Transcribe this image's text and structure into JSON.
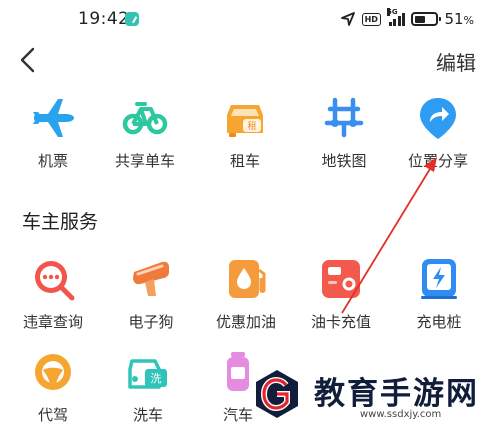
{
  "status_bar": {
    "time": "19:42",
    "network": "5G",
    "hd": "HD",
    "battery_text": "51",
    "battery_unit": "%",
    "battery_level": 0.51
  },
  "nav": {
    "back_icon": "chevron-left-icon",
    "edit_label": "编辑"
  },
  "top_grid": [
    {
      "label": "机票",
      "icon": "airplane-icon",
      "color": "#2aa3ee"
    },
    {
      "label": "共享单车",
      "icon": "bicycle-icon",
      "color": "#2ec8a0"
    },
    {
      "label": "租车",
      "icon": "rental-car-icon",
      "color": "#f7a531"
    },
    {
      "label": "地铁图",
      "icon": "subway-icon",
      "color": "#3a8ef0"
    },
    {
      "label": "位置分享",
      "icon": "location-share-icon",
      "color": "#2d9cf2"
    }
  ],
  "car_services": {
    "title": "车主服务",
    "row1": [
      {
        "label": "违章查询",
        "icon": "violation-search-icon",
        "color": "#f2554a"
      },
      {
        "label": "电子狗",
        "icon": "e-dog-icon",
        "color": "#f07a3c"
      },
      {
        "label": "优惠加油",
        "icon": "fuel-drop-icon",
        "color": "#f69b3b"
      },
      {
        "label": "油卡充值",
        "icon": "fuel-card-icon",
        "color": "#f25a4e"
      },
      {
        "label": "充电桩",
        "icon": "charging-station-icon",
        "color": "#2f8cf3"
      }
    ],
    "row2": [
      {
        "label": "代驾",
        "icon": "steering-wheel-icon",
        "color": "#f7a531"
      },
      {
        "label": "洗车",
        "icon": "car-wash-icon",
        "color": "#2ec5b8"
      },
      {
        "label": "汽车",
        "icon": "car-care-icon",
        "color": "#e58be0"
      }
    ]
  },
  "watermark": {
    "title": "教育手游网",
    "url": "www.ssdxjy.com"
  },
  "annotation_color": "#e1302a"
}
